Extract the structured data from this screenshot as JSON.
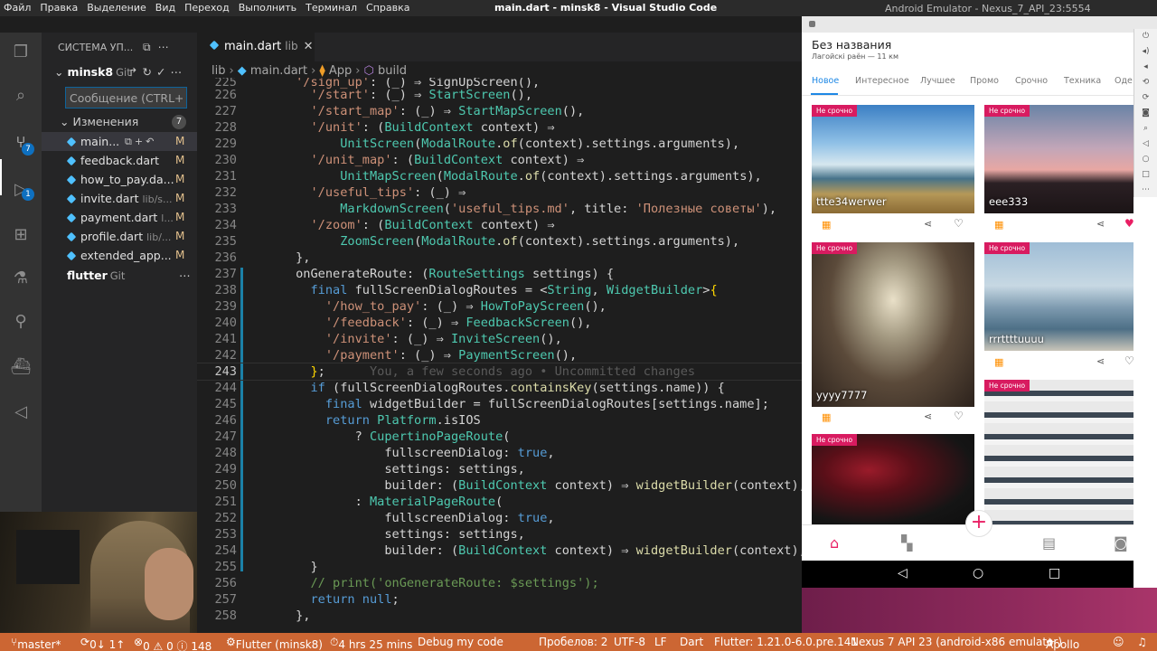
{
  "topbar": {
    "menus": [
      "Файл",
      "Правка",
      "Выделение",
      "Вид",
      "Переход",
      "Выполнить",
      "Терминал",
      "Справка"
    ],
    "vscode_title": "main.dart - minsk8 - Visual Studio Code",
    "emulator_title": "Android Emulator - Nexus_7_API_23:5554"
  },
  "activity": {
    "scm_badge": "7",
    "debug_badge": "1"
  },
  "sidebar": {
    "header": "СИСТЕМА УП...",
    "repo_name": "minsk8",
    "repo_git": "Git",
    "commit_placeholder": "Сообщение (CTRL+...",
    "changes_label": "Изменения",
    "changes_count": "7",
    "files": [
      {
        "name": "main...",
        "path": "",
        "status": "M"
      },
      {
        "name": "feedback.dart",
        "path": "",
        "status": "M"
      },
      {
        "name": "how_to_pay.da...",
        "path": "",
        "status": "M"
      },
      {
        "name": "invite.dart",
        "path": "lib/s...",
        "status": "M"
      },
      {
        "name": "payment.dart",
        "path": "l...",
        "status": "M"
      },
      {
        "name": "profile.dart",
        "path": "lib/...",
        "status": "M"
      },
      {
        "name": "extended_app...",
        "path": "",
        "status": "M"
      }
    ],
    "flutter_name": "flutter",
    "flutter_git": "Git"
  },
  "editor": {
    "tab_name": "main.dart",
    "tab_dir": "lib",
    "breadcrumb": [
      "lib",
      "main.dart",
      "App",
      "build"
    ],
    "blame": "You, a few seconds ago • Uncommitted changes"
  },
  "emulator": {
    "app_title": "Без названия",
    "app_subtitle": "Лагойскі раён — 11 км",
    "tabs": [
      "Новое",
      "Интересное",
      "Лучшее",
      "Промо",
      "Срочно",
      "Техника",
      "Оде"
    ],
    "label": "Не срочно",
    "cards": [
      {
        "name": "ttte34werwer",
        "liked": false
      },
      {
        "name": "eee333",
        "liked": true
      },
      {
        "name": "yyyy7777",
        "liked": false
      },
      {
        "name": "rrrttttuuuu",
        "liked": false
      },
      {
        "name": "",
        "liked": false
      },
      {
        "name": "",
        "liked": false
      }
    ]
  },
  "statusbar": {
    "branch": "master*",
    "sync": "0↓ 1↑",
    "problems": "0 ⚠ 0 ⓘ 148",
    "flutter": "Flutter (minsk8)",
    "time": "4 hrs 25 mins",
    "debug": "Debug my code",
    "spaces": "Пробелов: 2",
    "encoding": "UTF-8",
    "eol": "LF",
    "lang": "Dart",
    "flutter_ver": "Flutter: 1.21.0-6.0.pre.141",
    "device": "Nexus 7 API 23 (android-x86 emulator)",
    "apollo": "Apollo"
  }
}
